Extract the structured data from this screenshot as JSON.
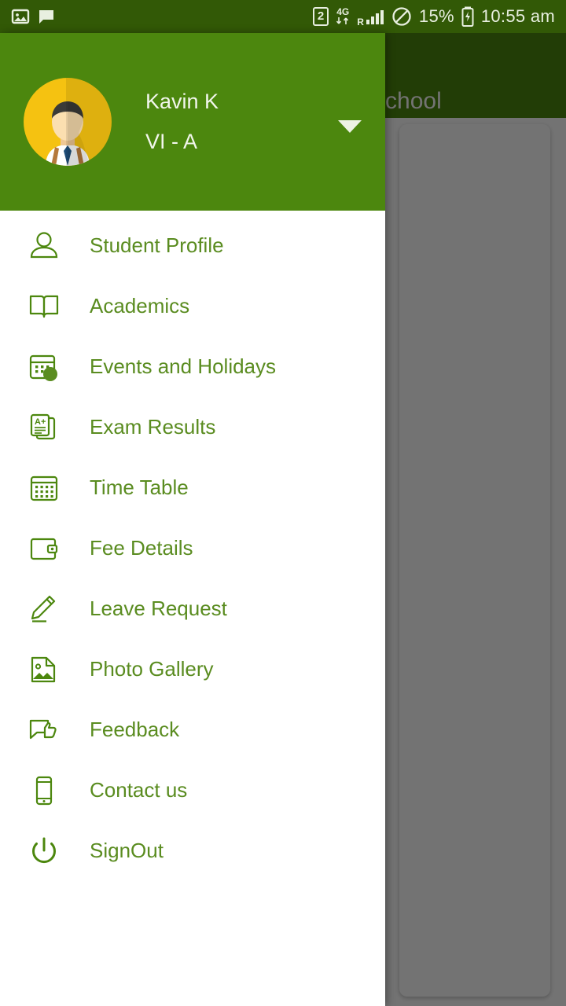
{
  "statusbar": {
    "left_icons": [
      {
        "name": "screenshot-icon"
      },
      {
        "name": "message-icon"
      }
    ],
    "sim_badge": "2",
    "network_label": "4G",
    "roaming_label": "R",
    "signal_icon": "signal-bars-icon",
    "dnd_icon": "do-not-disturb-icon",
    "battery_percent": "15%",
    "battery_icon": "battery-charging-icon",
    "clock": "10:55 am"
  },
  "background": {
    "appbar_title": "School",
    "card_name": "content-card"
  },
  "drawer": {
    "user": {
      "avatar": "student-avatar",
      "name": "Kavin K",
      "class": "VI - A",
      "caret": "chevron-down-icon"
    },
    "items": [
      {
        "label": "Student Profile",
        "icon": "person-icon"
      },
      {
        "label": "Academics",
        "icon": "open-book-icon"
      },
      {
        "label": "Events and Holidays",
        "icon": "calendar-badge-icon"
      },
      {
        "label": "Exam Results",
        "icon": "grade-document-icon"
      },
      {
        "label": "Time Table",
        "icon": "calendar-grid-icon"
      },
      {
        "label": "Fee Details",
        "icon": "wallet-icon"
      },
      {
        "label": "Leave Request",
        "icon": "pencil-icon"
      },
      {
        "label": "Photo Gallery",
        "icon": "photo-icon"
      },
      {
        "label": "Feedback",
        "icon": "feedback-thumb-icon"
      },
      {
        "label": "Contact us",
        "icon": "mobile-phone-icon"
      },
      {
        "label": "SignOut",
        "icon": "power-icon"
      }
    ]
  },
  "colors": {
    "brand_green": "#4C870E",
    "statusbar_green": "#325906",
    "menu_text_green": "#5a8c20",
    "avatar_yellow": "#F5C211"
  }
}
